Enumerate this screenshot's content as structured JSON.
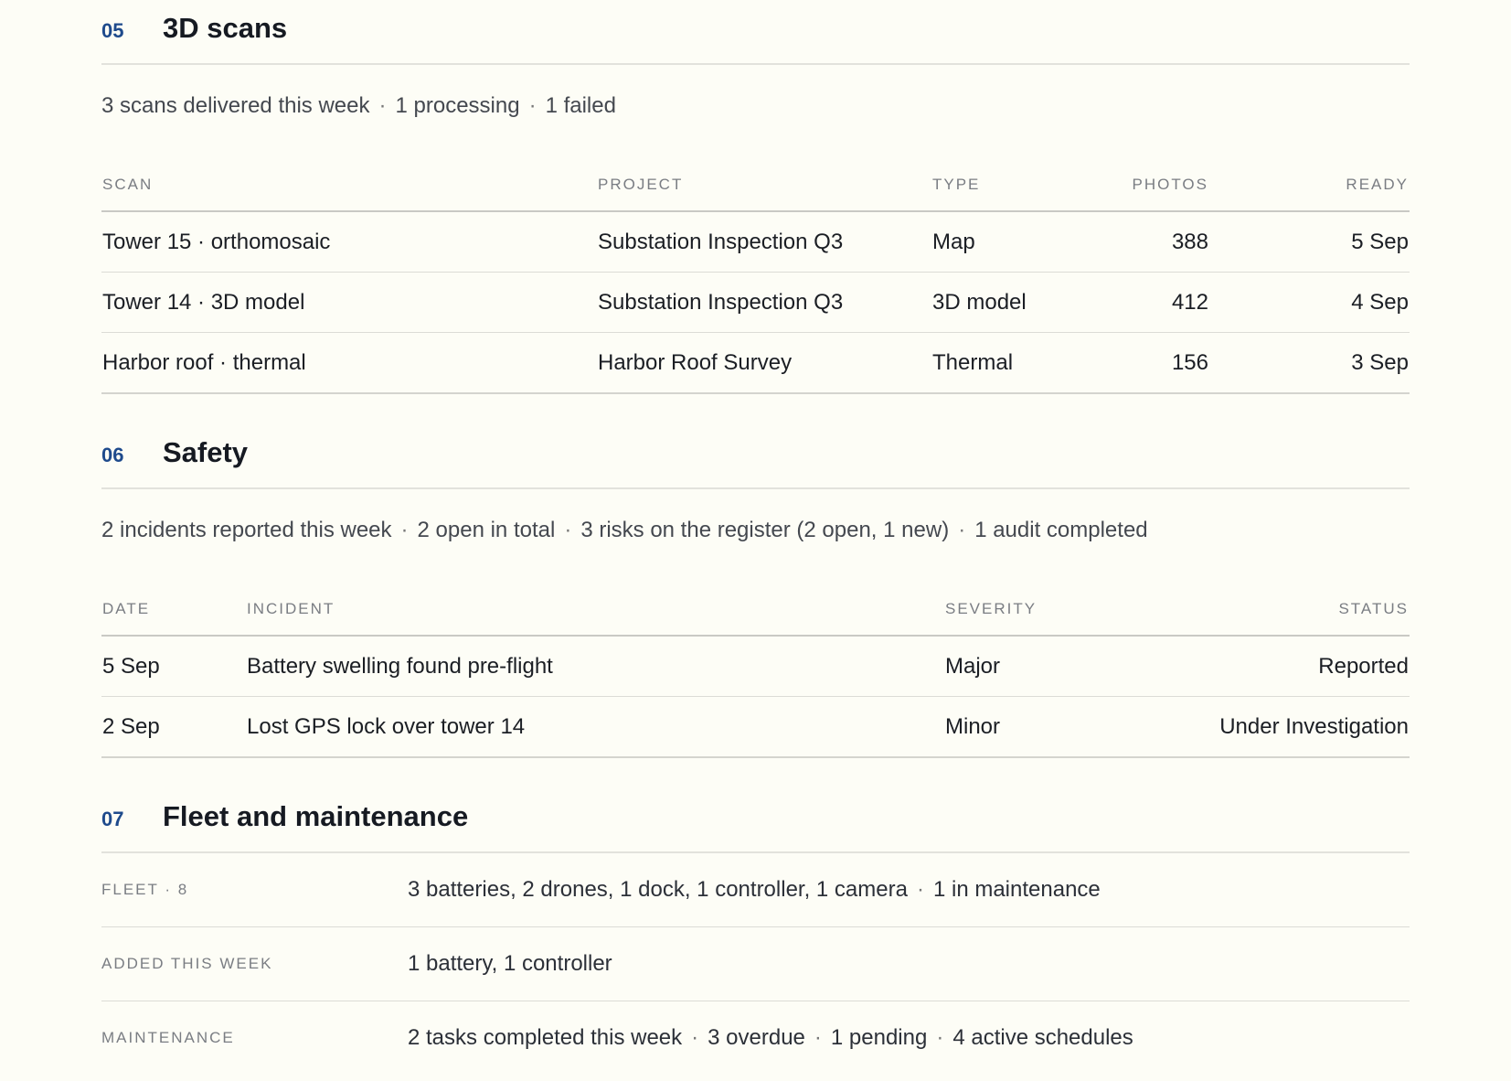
{
  "scans": {
    "number": "05",
    "title": "3D scans",
    "summary": [
      "3 scans delivered this week",
      "1 processing",
      "1 failed"
    ],
    "columns": [
      "SCAN",
      "PROJECT",
      "TYPE",
      "PHOTOS",
      "READY"
    ],
    "rows": [
      {
        "scan": "Tower 15 · orthomosaic",
        "project": "Substation Inspection Q3",
        "type": "Map",
        "photos": "388",
        "ready": "5 Sep"
      },
      {
        "scan": "Tower 14 · 3D model",
        "project": "Substation Inspection Q3",
        "type": "3D model",
        "photos": "412",
        "ready": "4 Sep"
      },
      {
        "scan": "Harbor roof · thermal",
        "project": "Harbor Roof Survey",
        "type": "Thermal",
        "photos": "156",
        "ready": "3 Sep"
      }
    ]
  },
  "safety": {
    "number": "06",
    "title": "Safety",
    "summary": [
      "2 incidents reported this week",
      "2 open in total",
      "3 risks on the register (2 open, 1 new)",
      "1 audit completed"
    ],
    "columns": [
      "DATE",
      "INCIDENT",
      "SEVERITY",
      "STATUS"
    ],
    "rows": [
      {
        "date": "5 Sep",
        "incident": "Battery swelling found pre-flight",
        "severity": "Major",
        "status": "Reported"
      },
      {
        "date": "2 Sep",
        "incident": "Lost GPS lock over tower 14",
        "severity": "Minor",
        "status": "Under Investigation"
      }
    ],
    "severity_major_color": "#b3262a"
  },
  "fleet": {
    "number": "07",
    "title": "Fleet and maintenance",
    "rows": [
      {
        "label": "FLEET · 8",
        "parts": [
          "3 batteries, 2 drones, 1 dock, 1 controller, 1 camera",
          "1 in maintenance"
        ]
      },
      {
        "label": "ADDED THIS WEEK",
        "parts": [
          "1 battery, 1 controller"
        ]
      },
      {
        "label": "MAINTENANCE",
        "parts": [
          "2 tasks completed this week",
          "3 overdue",
          "1 pending",
          "4 active schedules"
        ]
      }
    ]
  },
  "colors": {
    "accent": "#1e4a8c",
    "background": "#fdfdf6"
  }
}
